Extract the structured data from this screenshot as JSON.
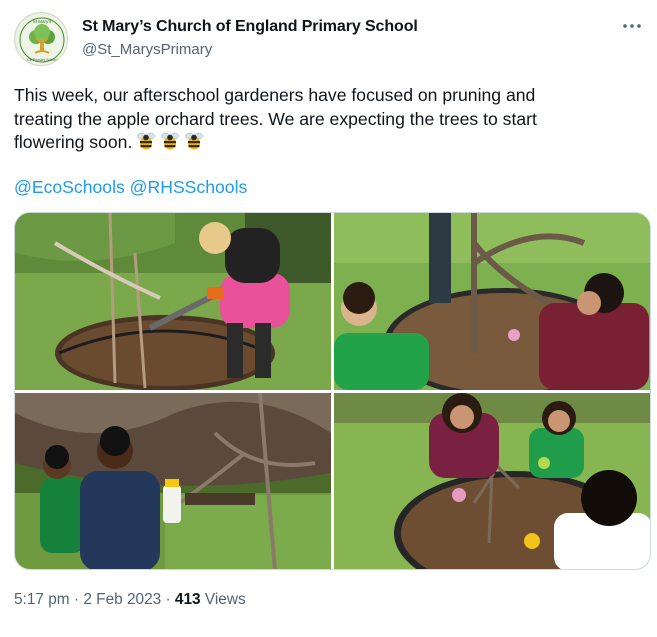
{
  "account": {
    "name": "St Mary’s Church of England Primary School",
    "handle": "@St_MarysPrimary",
    "avatar_label": "St Mary's",
    "avatar_sub": "CE Primary School"
  },
  "menu_icon": "more-horizontal-icon",
  "tweet": {
    "lines": [
      "This week, our afterschool gardeners have focused on pruning and",
      "treating the apple orchard trees.  We are expecting the trees to start",
      "flowering soon."
    ],
    "emoji": "bee",
    "emoji_count": 3,
    "hashtags": [
      "@EcoSchools",
      "@RHSSchools"
    ]
  },
  "media": {
    "count": 4,
    "photos": [
      {
        "description": "Child in pink coat sawing a branch by a mulched tree bed"
      },
      {
        "description": "Two children in green and maroon tending an apple tree bed"
      },
      {
        "description": "Two boys in blue and navy holding a spray bottle near a young tree"
      },
      {
        "description": "Three children with gloves working in a mulched tree bed"
      }
    ]
  },
  "meta": {
    "time": "5:17 pm",
    "separator": "·",
    "date": "2 Feb 2023",
    "views_count": "413",
    "views_label": "Views"
  },
  "colors": {
    "link": "#1d9bf0",
    "secondary_text": "#536471",
    "primary_text": "#0f1419",
    "border": "#cfd9de"
  }
}
